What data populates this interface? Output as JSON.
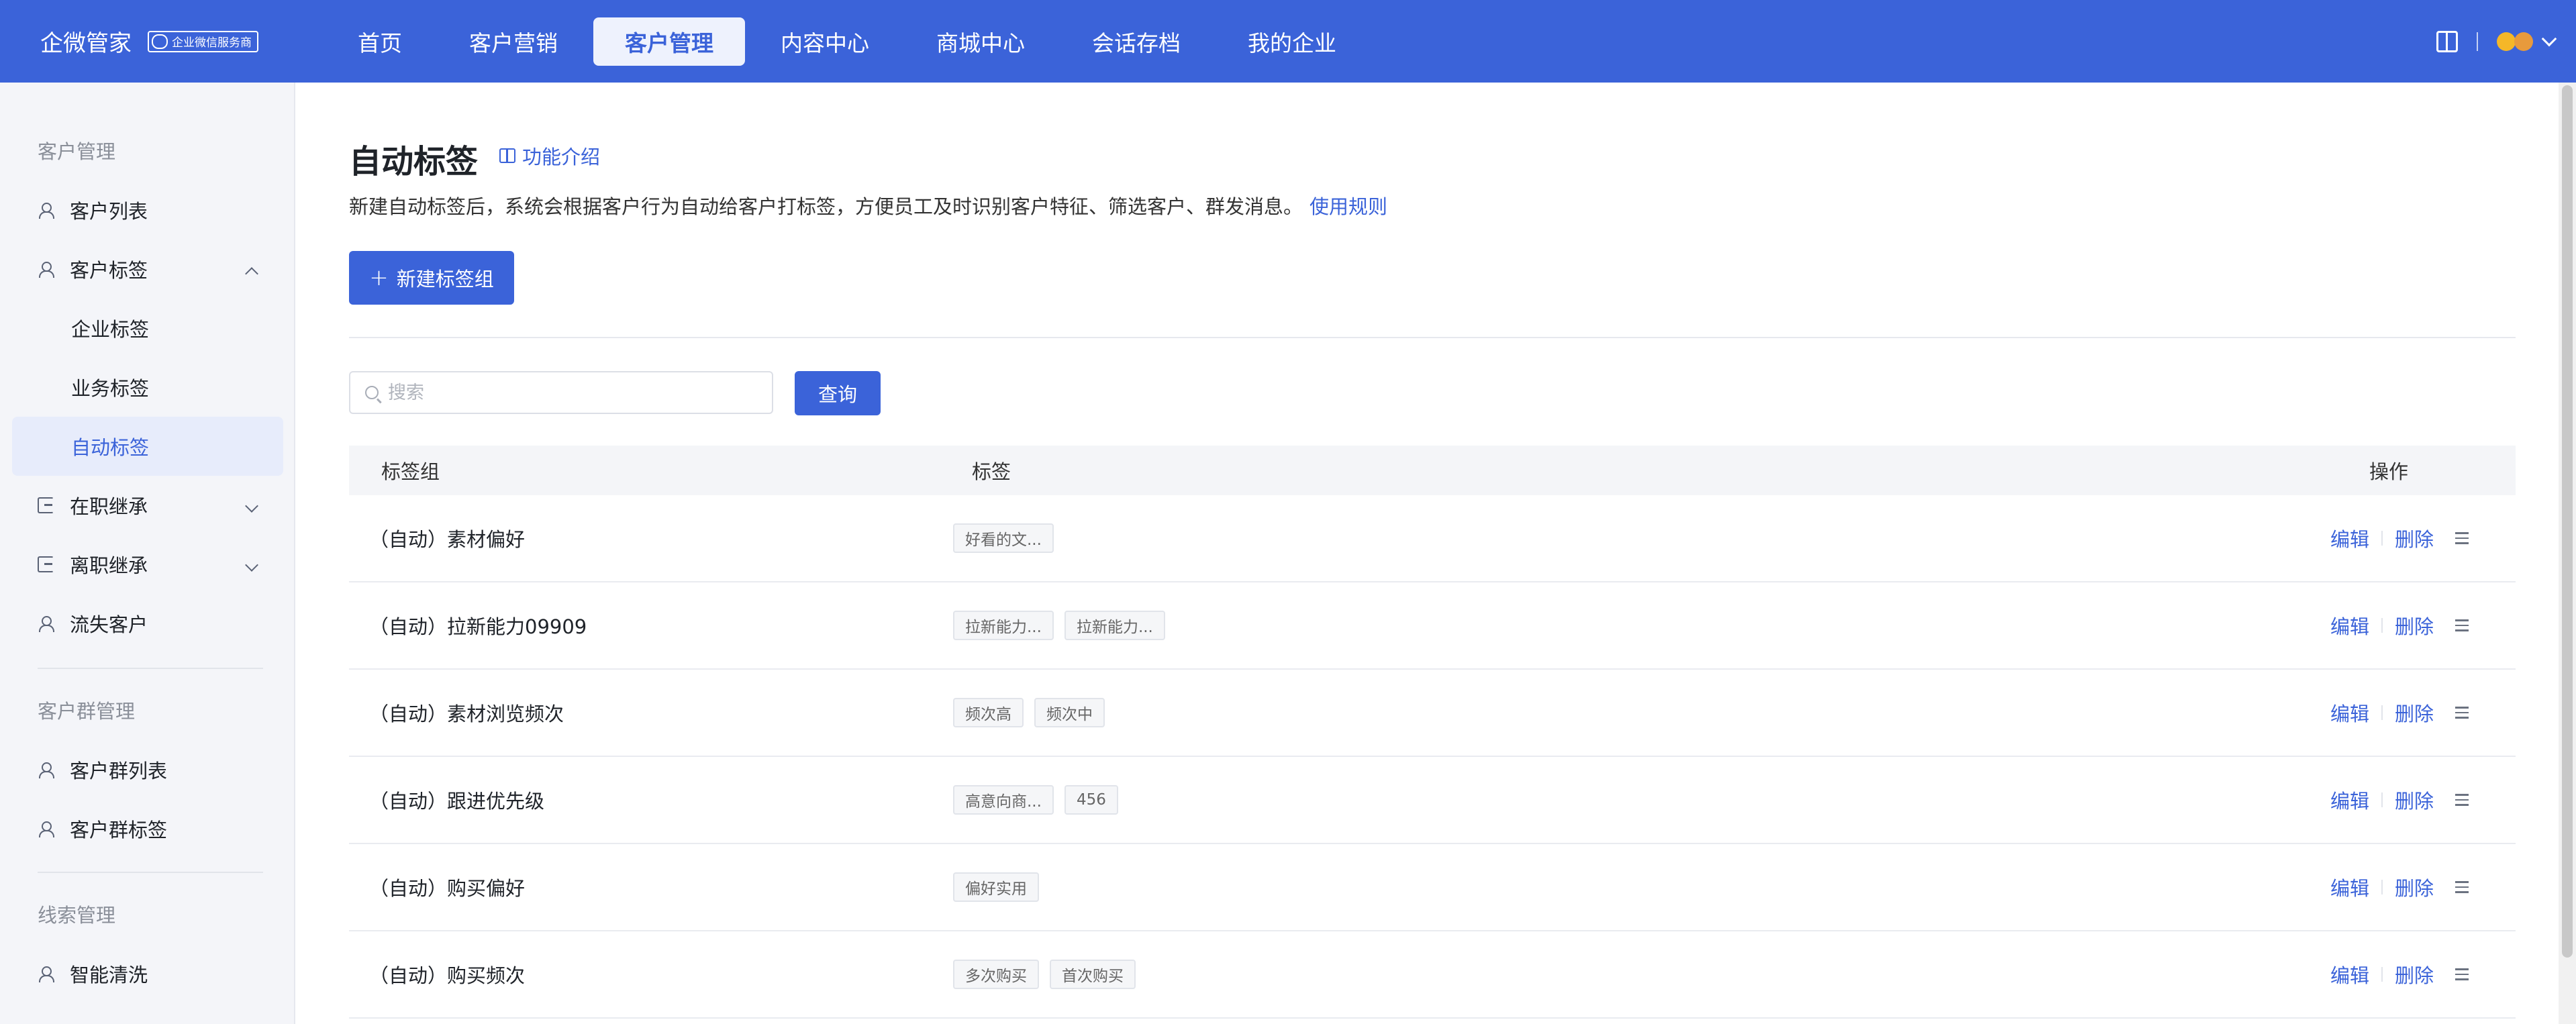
{
  "brand": {
    "name": "企微管家",
    "badge": "企业微信服务商"
  },
  "nav": {
    "items": [
      {
        "label": "首页"
      },
      {
        "label": "客户营销"
      },
      {
        "label": "客户管理"
      },
      {
        "label": "内容中心"
      },
      {
        "label": "商城中心"
      },
      {
        "label": "会话存档"
      },
      {
        "label": "我的企业"
      }
    ],
    "active": "客户管理"
  },
  "sidebar": {
    "sections": [
      {
        "title": "客户管理"
      },
      {
        "title": "客户群管理"
      },
      {
        "title": "线索管理"
      }
    ],
    "items": [
      {
        "label": "客户列表",
        "icon": "user-icon"
      },
      {
        "label": "客户标签",
        "icon": "user-tag-icon"
      },
      {
        "label": "企业标签"
      },
      {
        "label": "业务标签"
      },
      {
        "label": "自动标签"
      },
      {
        "label": "在职继承",
        "icon": "exit-icon"
      },
      {
        "label": "离职继承",
        "icon": "exit-icon"
      },
      {
        "label": "流失客户",
        "icon": "user-icon"
      },
      {
        "label": "客户群列表",
        "icon": "group-icon"
      },
      {
        "label": "客户群标签",
        "icon": "group-tag-icon"
      },
      {
        "label": "智能清洗",
        "icon": "user-icon"
      }
    ]
  },
  "main": {
    "title": "自动标签",
    "intro_link": "功能介绍",
    "description": "新建自动标签后，系统会根据客户行为自动给客户打标签，方便员工及时识别客户特征、筛选客户、群发消息。",
    "rules_link": "使用规则",
    "new_button": "新建标签组",
    "search_placeholder": "搜索",
    "query_button": "查询",
    "table": {
      "headers": [
        "标签组",
        "标签",
        "操作"
      ],
      "rows": [
        {
          "name": "（自动）素材偏好",
          "tags": [
            "好看的文..."
          ]
        },
        {
          "name": "（自动）拉新能力09909",
          "tags": [
            "拉新能力...",
            "拉新能力..."
          ]
        },
        {
          "name": "（自动）素材浏览频次",
          "tags": [
            "频次高",
            "频次中"
          ]
        },
        {
          "name": "（自动）跟进优先级",
          "tags": [
            "高意向商...",
            "456"
          ]
        },
        {
          "name": "（自动）购买偏好",
          "tags": [
            "偏好实用"
          ]
        },
        {
          "name": "（自动）购买频次",
          "tags": [
            "多次购买",
            "首次购买"
          ]
        }
      ],
      "edit_label": "编辑",
      "delete_label": "删除"
    }
  },
  "colors": {
    "primary": "#3b63d9",
    "active_bg": "#e7ecfb"
  }
}
